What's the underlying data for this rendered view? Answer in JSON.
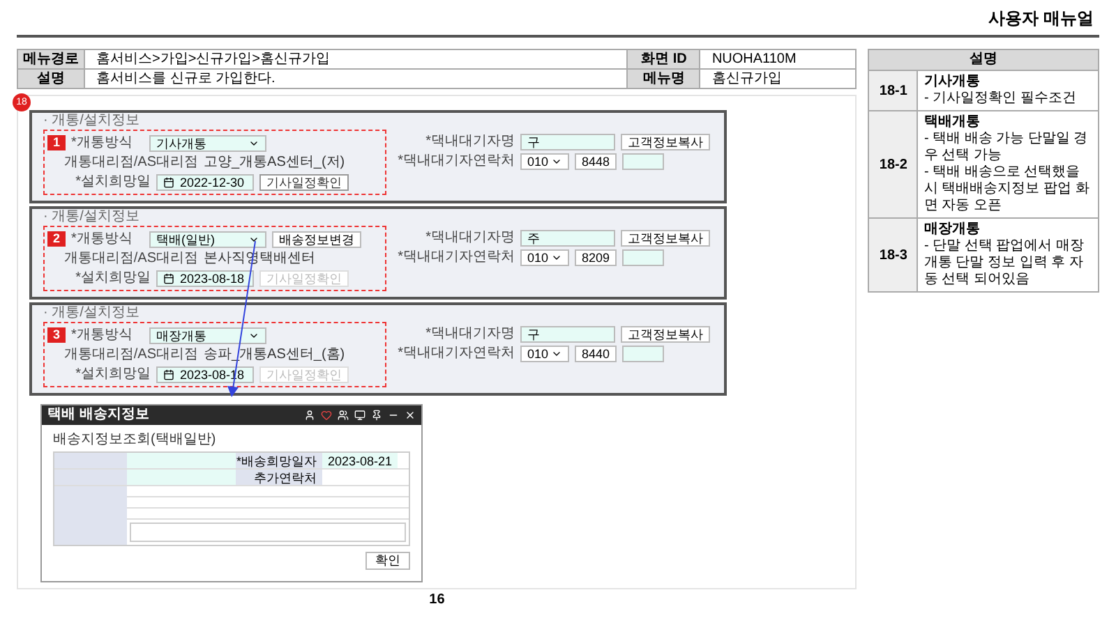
{
  "header": {
    "title": "사용자 매뉴얼"
  },
  "info_table": [
    {
      "label": "메뉴경로",
      "value": "홈서비스>가입>신규가입>홈신규가입",
      "label2": "화면 ID",
      "value2": "NUOHA110M"
    },
    {
      "label": "설명",
      "value": "홈서비스를 신규로 가입한다.",
      "label2": "메뉴명",
      "value2": "홈신규가입"
    }
  ],
  "step_badge": "18",
  "panels": [
    {
      "title": "· 개통/설치정보",
      "marker": "1",
      "method_label": "*개통방식",
      "method": "기사개통",
      "agency_label": "개통대리점/AS대리점",
      "agency": "고양_개통AS센터_(저)",
      "date_label": "*설치희망일",
      "date": "2022-12-30",
      "schedule_button": {
        "label": "기사일정확인",
        "disabled": false
      },
      "waiter_label": "*댁내대기자명",
      "waiter": "구",
      "copy_button": "고객정보복사",
      "phone_label": "*댁내대기자연락처",
      "phone_prefix": "010",
      "phone_mid": "8448"
    },
    {
      "title": "· 개통/설치정보",
      "marker": "2",
      "method_label": "*개통방식",
      "method": "택배(일반)",
      "change_button": "배송정보변경",
      "agency_label": "개통대리점/AS대리점",
      "agency": "본사직영택배센터",
      "date_label": "*설치희망일",
      "date": "2023-08-18",
      "schedule_button": {
        "label": "기사일정확인",
        "disabled": true
      },
      "waiter_label": "*댁내대기자명",
      "waiter": "주",
      "copy_button": "고객정보복사",
      "phone_label": "*댁내대기자연락처",
      "phone_prefix": "010",
      "phone_mid": "8209"
    },
    {
      "title": "· 개통/설치정보",
      "marker": "3",
      "method_label": "*개통방식",
      "method": "매장개통",
      "agency_label": "개통대리점/AS대리점",
      "agency": "송파_개통AS센터_(홈)",
      "date_label": "*설치희망일",
      "date": "2023-08-18",
      "schedule_button": {
        "label": "기사일정확인",
        "disabled": true
      },
      "waiter_label": "*댁내대기자명",
      "waiter": "구",
      "copy_button": "고객정보복사",
      "phone_label": "*댁내대기자연락처",
      "phone_prefix": "010",
      "phone_mid": "8440"
    }
  ],
  "popup": {
    "title": "택배 배송지정보",
    "subtitle": "배송지정보조회(택배일반)",
    "date_label": "*배송희망일자",
    "date": "2023-08-21",
    "extra_label": "추가연락처",
    "ok_button": "확인"
  },
  "page_number": "16",
  "description": {
    "header": "설명",
    "rows": [
      {
        "id": "18-1",
        "title": "기사개통",
        "lines": [
          "- 기사일정확인 필수조건"
        ]
      },
      {
        "id": "18-2",
        "title": "택배개통",
        "lines": [
          "- 택배 배송 가능 단말일 경우 선택 가능",
          "- 택배 배송으로 선택했을 시 택배배송지정보 팝업 화면 자동 오픈"
        ]
      },
      {
        "id": "18-3",
        "title": "매장개통",
        "lines": [
          "- 단말 선택 팝업에서 매장개통 단말 정보 입력 후 자동 선택 되어있음"
        ]
      }
    ]
  }
}
